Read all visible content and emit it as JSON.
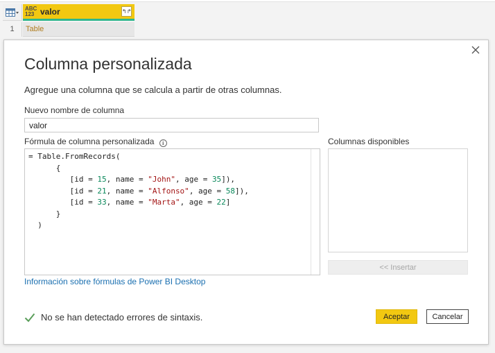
{
  "grid": {
    "type_badge_top": "ABC",
    "type_badge_bottom": "123",
    "column_name": "valor",
    "column_button": "↰↱",
    "row_number": "1",
    "cell_value": "Table"
  },
  "dialog": {
    "title": "Columna personalizada",
    "description": "Agregue una columna que se calcula a partir de otras columnas.",
    "name_label": "Nuevo nombre de columna",
    "name_value": "valor",
    "formula_label": "Fórmula de columna personalizada",
    "info_icon": "i",
    "columns_label": "Columnas disponibles",
    "columns_available": [],
    "insert_label": "<< Insertar",
    "help_link": "Información sobre fórmulas de Power BI Desktop",
    "status_text": "No se han detectado errores de sintaxis.",
    "ok_label": "Aceptar",
    "cancel_label": "Cancelar"
  },
  "formula": {
    "line1": "= Table.FromRecords(",
    "line2": "{",
    "records": [
      {
        "id": "15",
        "name": "\"John\"",
        "age": "35",
        "trail": "),"
      },
      {
        "id": "21",
        "name": "\"Alfonso\"",
        "age": "58",
        "trail": "),"
      },
      {
        "id": "33",
        "name": "\"Marta\"",
        "age": "22",
        "trail": ")"
      }
    ],
    "line6": "}",
    "line7": ")"
  },
  "colors": {
    "accent_yellow": "#f2c811",
    "accent_green": "#2fb68e",
    "link_blue": "#1a6fb0",
    "number_green": "#09885a",
    "string_red": "#a31515",
    "check_green": "#5a9e5a"
  },
  "icons": {
    "table": "table-icon",
    "close": "close-icon",
    "info": "info-icon",
    "check": "check-icon"
  }
}
